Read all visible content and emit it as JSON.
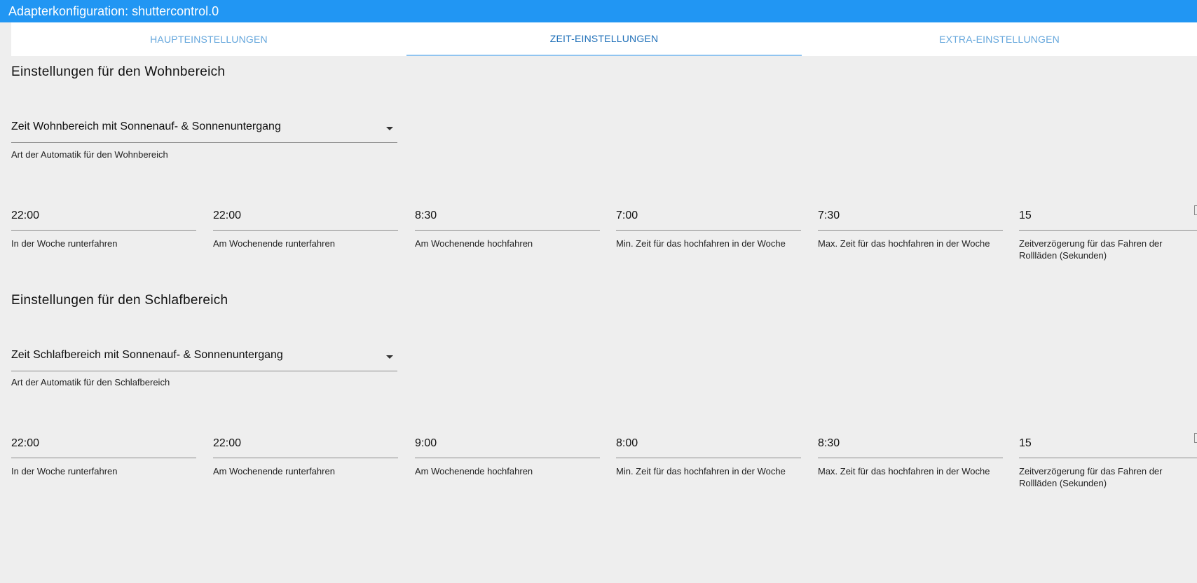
{
  "window": {
    "title": "Adapterkonfiguration: shuttercontrol.0"
  },
  "tabs": [
    {
      "label": "HAUPTEINSTELLUNGEN",
      "active": false
    },
    {
      "label": "ZEIT-EINSTELLUNGEN",
      "active": true
    },
    {
      "label": "EXTRA-EINSTELLUNGEN",
      "active": false
    }
  ],
  "living": {
    "title": "Einstellungen für den Wohnbereich",
    "select_value": "Zeit Wohnbereich mit Sonnenauf- & Sonnenuntergang",
    "select_helper": "Art der Automatik für den Wohnbereich",
    "fields": [
      {
        "value": "22:00",
        "label": "In der Woche runterfahren"
      },
      {
        "value": "22:00",
        "label": "Am Wochenende runterfahren"
      },
      {
        "value": "8:30",
        "label": "Am Wochenende hochfahren"
      },
      {
        "value": "7:00",
        "label": "Min. Zeit für das hochfahren in der Woche"
      },
      {
        "value": "7:30",
        "label": "Max. Zeit für das hochfahren in der Woche"
      },
      {
        "value": "15",
        "label": "Zeitverzögerung für das Fahren der Rollläden (Sekunden)"
      }
    ]
  },
  "sleeping": {
    "title": "Einstellungen für den Schlafbereich",
    "select_value": "Zeit Schlafbereich mit Sonnenauf- & Sonnenuntergang",
    "select_helper": "Art der Automatik für den Schlafbereich",
    "fields": [
      {
        "value": "22:00",
        "label": "In der Woche runterfahren"
      },
      {
        "value": "22:00",
        "label": "Am Wochenende runterfahren"
      },
      {
        "value": "9:00",
        "label": "Am Wochenende hochfahren"
      },
      {
        "value": "8:00",
        "label": "Min. Zeit für das hochfahren in der Woche"
      },
      {
        "value": "8:30",
        "label": "Max. Zeit für das hochfahren in der Woche"
      },
      {
        "value": "15",
        "label": "Zeitverzögerung für das Fahren der Rollläden (Sekunden)"
      }
    ]
  },
  "colors": {
    "titlebar": "#2196f3",
    "tab_text": "#64a6dc",
    "tab_active_text": "#1e6fb8",
    "tab_indicator": "#90c4f0",
    "background": "#eeeeee"
  }
}
